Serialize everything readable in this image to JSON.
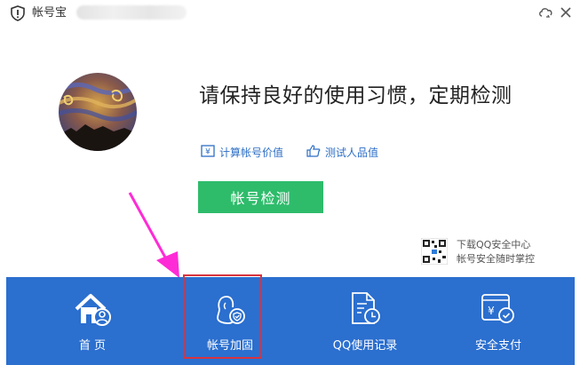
{
  "window": {
    "app_name": "帐号宝",
    "icon": "shield-icon"
  },
  "titlebar": {
    "buttons": [
      "refresh-icon",
      "close-icon"
    ]
  },
  "main": {
    "headline": "请保持良好的使用习惯，定期检测",
    "links": [
      {
        "label": "计算帐号价值",
        "icon": "calculator-icon"
      },
      {
        "label": "测试人品值",
        "icon": "thumbs-up-icon"
      }
    ],
    "check_button": "帐号检测"
  },
  "promo": {
    "line1": "下载QQ安全中心",
    "line2": "帐号安全随时掌控"
  },
  "nav": {
    "items": [
      {
        "label": "首 页",
        "icon": "home-icon"
      },
      {
        "label": "帐号加固",
        "icon": "account-shield-icon"
      },
      {
        "label": "QQ使用记录",
        "icon": "usage-record-icon"
      },
      {
        "label": "安全支付",
        "icon": "secure-payment-icon"
      }
    ]
  },
  "colors": {
    "nav_bg": "#2b6fcf",
    "check_button": "#2ebc6b",
    "link": "#2c6ec6",
    "highlight": "#d9333f",
    "arrow": "#ff2bd6"
  }
}
